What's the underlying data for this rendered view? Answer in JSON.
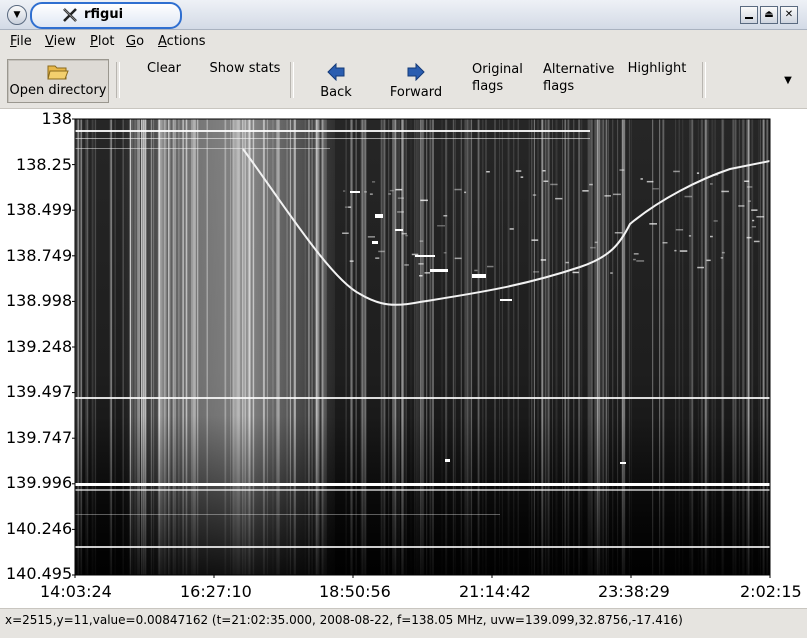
{
  "window": {
    "title": "rfigui"
  },
  "menu": [
    {
      "key": "F",
      "rest": "ile"
    },
    {
      "key": "V",
      "rest": "iew"
    },
    {
      "key": "P",
      "rest": "lot"
    },
    {
      "key": "G",
      "rest": "o"
    },
    {
      "key": "A",
      "rest": "ctions"
    }
  ],
  "toolbar": {
    "open_directory": "Open directory",
    "clear": "Clear",
    "show_stats": "Show stats",
    "back": "Back",
    "forward": "Forward",
    "original_flags_1": "Original",
    "original_flags_2": "flags",
    "alternative_flags_1": "Alternative",
    "alternative_flags_2": "flags",
    "highlight": "Highlight"
  },
  "plot": {
    "y_ticks": [
      "138",
      "138.25",
      "138.499",
      "138.749",
      "138.998",
      "139.248",
      "139.497",
      "139.747",
      "139.996",
      "140.246",
      "140.495"
    ],
    "x_ticks": [
      "14:03:24",
      "16:27:10",
      "18:50:56",
      "21:14:42",
      "23:38:29",
      "2:02:15"
    ]
  },
  "status": {
    "text": "x=2515,y=11,value=0.00847162 (t=21:02:35.000, 2008-08-22, f=138.05 MHz, uvw=139.099,32.8756,-17.416)"
  },
  "colors": {
    "title_accent": "#2f6fd0",
    "arrow": "#2a5db0"
  }
}
